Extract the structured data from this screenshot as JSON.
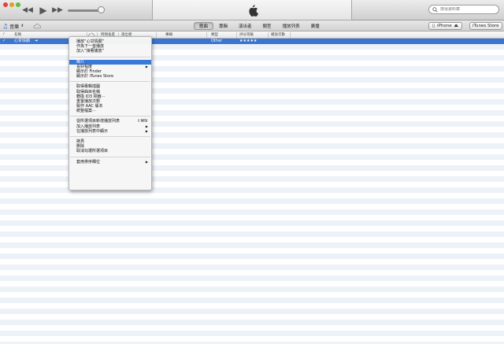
{
  "search": {
    "placeholder": "搜尋資料庫"
  },
  "navbar": {
    "media_label": "音樂",
    "tabs": [
      {
        "label": "歌曲",
        "active": true
      },
      {
        "label": "專輯",
        "active": false
      },
      {
        "label": "演出者",
        "active": false
      },
      {
        "label": "類型",
        "active": false
      },
      {
        "label": "播放列表",
        "active": false
      },
      {
        "label": "廣播",
        "active": false
      }
    ],
    "device_label": "iPhone",
    "store_label": "iTunes Store"
  },
  "columns": [
    "名稱",
    "時間長度",
    "演出者",
    "專輯",
    "類型",
    "評分等級",
    "播放次數"
  ],
  "rows": [
    {
      "name": "心甘情願",
      "genre": "Other",
      "rating": "★★★★★",
      "selected": true
    }
  ],
  "context_menu": {
    "groups": [
      [
        {
          "label": "播放“心甘情願”"
        },
        {
          "label": "作為下一首播放"
        },
        {
          "label": "加入“接著播放”"
        }
      ],
      [
        {
          "label": "簡介",
          "highlighted": true
        },
        {
          "label": "喜好程度",
          "submenu": true
        },
        {
          "label": "顯示於 Finder"
        },
        {
          "label": "顯示於 iTunes Store"
        }
      ],
      [
        {
          "label": "取得專輯插圖"
        },
        {
          "label": "取得曲目名稱"
        },
        {
          "label": "轉換 ID3 標籤⋯"
        },
        {
          "label": "重置播放次數"
        },
        {
          "label": "製作 AAC 版本"
        },
        {
          "label": "統整檔案⋯"
        }
      ],
      [
        {
          "label": "從所選項目新增播放列表",
          "shortcut": "⇧⌘N"
        },
        {
          "label": "加入播放列表",
          "submenu": true
        },
        {
          "label": "在播放列表中顯示",
          "submenu": true
        }
      ],
      [
        {
          "label": "拷貝"
        },
        {
          "label": "刪除"
        },
        {
          "label": "取消勾選所選項目"
        }
      ],
      [
        {
          "label": "套用排序欄位",
          "submenu": true
        }
      ]
    ]
  },
  "colors": {
    "selection": "#3b75cf",
    "menu_highlight": "#3879d9",
    "row_stripe": "#edf2f8"
  }
}
